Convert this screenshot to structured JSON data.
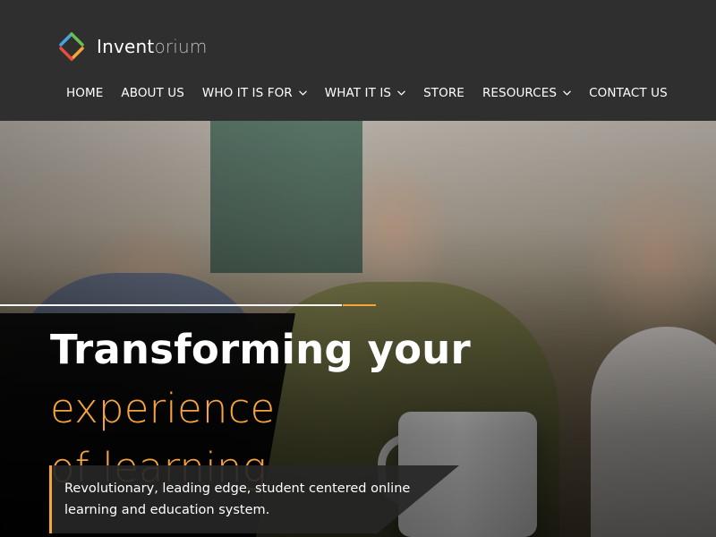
{
  "brand": {
    "name_part1": "Invent",
    "name_part2": "orium",
    "logo_colors": [
      "#4aa3df",
      "#6cc04a",
      "#f6a43b",
      "#e84c3d"
    ]
  },
  "nav": {
    "items": [
      {
        "label": "HOME",
        "has_dropdown": false
      },
      {
        "label": "ABOUT US",
        "has_dropdown": false
      },
      {
        "label": "WHO IT IS FOR",
        "has_dropdown": true
      },
      {
        "label": "WHAT IT IS",
        "has_dropdown": true
      },
      {
        "label": "STORE",
        "has_dropdown": false
      },
      {
        "label": "RESOURCES",
        "has_dropdown": true
      },
      {
        "label": "CONTACT US",
        "has_dropdown": false
      }
    ]
  },
  "hero": {
    "headline_white": "Transforming your",
    "headline_orange_1": "experience",
    "headline_orange_2": "of learning",
    "tagline_line1": "Revolutionary, leading edge, student centered online",
    "tagline_line2": "learning and education system.",
    "accent_color": "#f6a43b"
  }
}
